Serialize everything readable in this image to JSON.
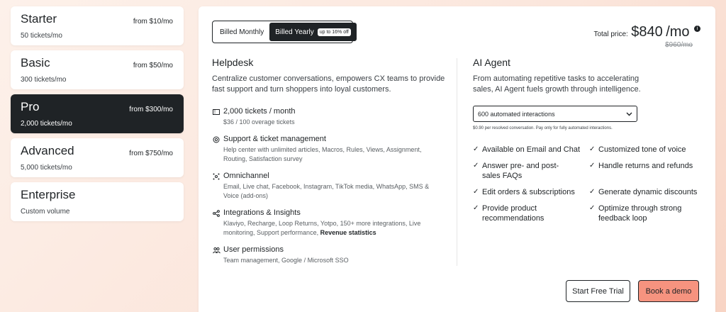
{
  "plans": [
    {
      "name": "Starter",
      "sub": "50 tickets/mo",
      "price": "from $10/mo"
    },
    {
      "name": "Basic",
      "sub": "300 tickets/mo",
      "price": "from $50/mo"
    },
    {
      "name": "Pro",
      "sub": "2,000 tickets/mo",
      "price": "from $300/mo"
    },
    {
      "name": "Advanced",
      "sub": "5,000 tickets/mo",
      "price": "from $750/mo"
    },
    {
      "name": "Enterprise",
      "sub": "Custom volume",
      "price": ""
    }
  ],
  "billing": {
    "monthly": "Billed Monthly",
    "yearly": "Billed Yearly",
    "badge": "up to 16% off"
  },
  "total": {
    "label": "Total price:",
    "amount": "$840",
    "unit": "/mo",
    "old": "$960/mo"
  },
  "helpdesk": {
    "title": "Helpdesk",
    "desc": "Centralize customer conversations, empowers CX teams to provide fast support and turn shoppers into loyal customers.",
    "features": [
      {
        "title": "2,000 tickets / month",
        "desc": "$36 / 100 overage tickets"
      },
      {
        "title": "Support & ticket management",
        "desc": "Help center with unlimited articles, Macros, Rules, Views, Assignment, Routing, Satisfaction survey"
      },
      {
        "title": "Omnichannel",
        "desc": "Email, Live chat, Facebook, Instagram, TikTok media, WhatsApp, SMS & Voice (add-ons)"
      },
      {
        "title": "Integrations & Insights",
        "desc": "Klaviyo, Recharge, Loop Returns, Yotpo, 150+ more integrations, Live monitoring, Support performance,",
        "bold": "Revenue statistics"
      },
      {
        "title": "User permissions",
        "desc": "Team management, Google / Microsoft SSO"
      }
    ]
  },
  "agent": {
    "title": "AI Agent",
    "desc": "From automating repetitive tasks to accelerating sales, AI Agent fuels growth through intelligence.",
    "select": "600 automated interactions",
    "note": "$0.90 per resolved conversation. Pay only for fully automated interactions.",
    "checks": [
      "Available on Email and Chat",
      "Customized tone of voice",
      "Answer pre- and post-sales FAQs",
      "Handle returns and refunds",
      "Edit orders & subscriptions",
      "Generate dynamic discounts",
      "Provide product recommendations",
      "Optimize through strong feedback loop"
    ]
  },
  "buttons": {
    "trial": "Start Free Trial",
    "demo": "Book a demo"
  }
}
